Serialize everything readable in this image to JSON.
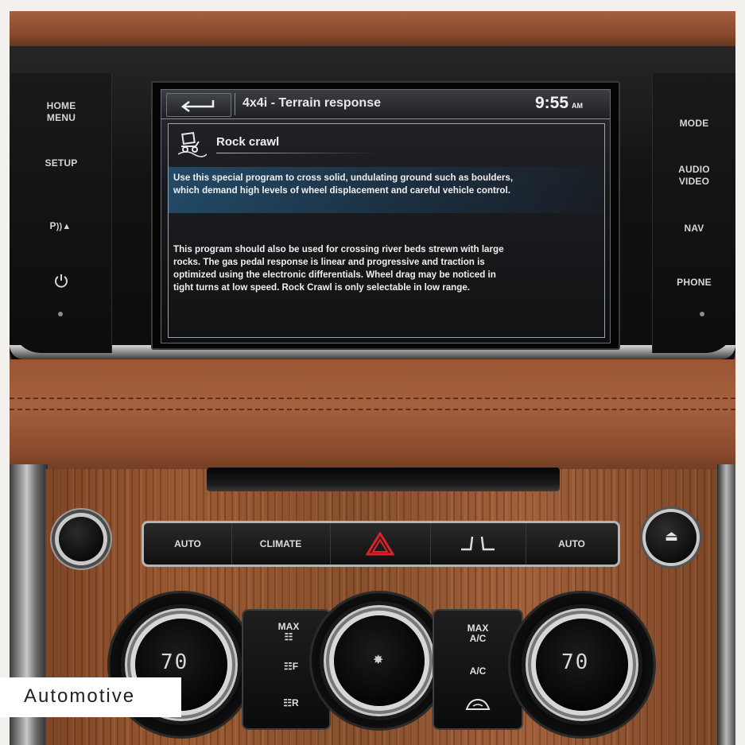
{
  "left_panel": {
    "home_menu": "HOME\nMENU",
    "setup": "SETUP",
    "parking": "P",
    "power_icon": "power-icon"
  },
  "right_panel": {
    "mode": "MODE",
    "audio_video": "AUDIO\nVIDEO",
    "nav": "NAV",
    "phone": "PHONE"
  },
  "screen": {
    "title": "4x4i - Terrain response",
    "time": "9:55",
    "ampm": "AM",
    "heading": "Rock crawl",
    "paragraph1_line1": "Use this special program to cross solid, undulating ground such as boulders,",
    "paragraph1_line2": "which demand high levels of wheel displacement and careful vehicle control.",
    "paragraph2_line1": "This program should also be used for crossing river beds strewn with large",
    "paragraph2_line2": "rocks. The gas pedal response is linear and progressive and traction is",
    "paragraph2_line3": "optimized using the electronic differentials. Wheel drag may be noticed in",
    "paragraph2_line4": "tight turns at low speed. Rock Crawl is only selectable in low range."
  },
  "climate": {
    "auto_left": "AUTO",
    "climate": "CLIMATE",
    "auto_right": "AUTO",
    "hazard_color": "#e0202a",
    "left_temp": "70",
    "right_temp": "70",
    "max_left": "MAX",
    "front_label": "F",
    "rear_label": "R",
    "max_right": "MAX",
    "ac_right_top": "A/C",
    "ac": "A/C"
  },
  "badge": {
    "label": "Automotive"
  }
}
